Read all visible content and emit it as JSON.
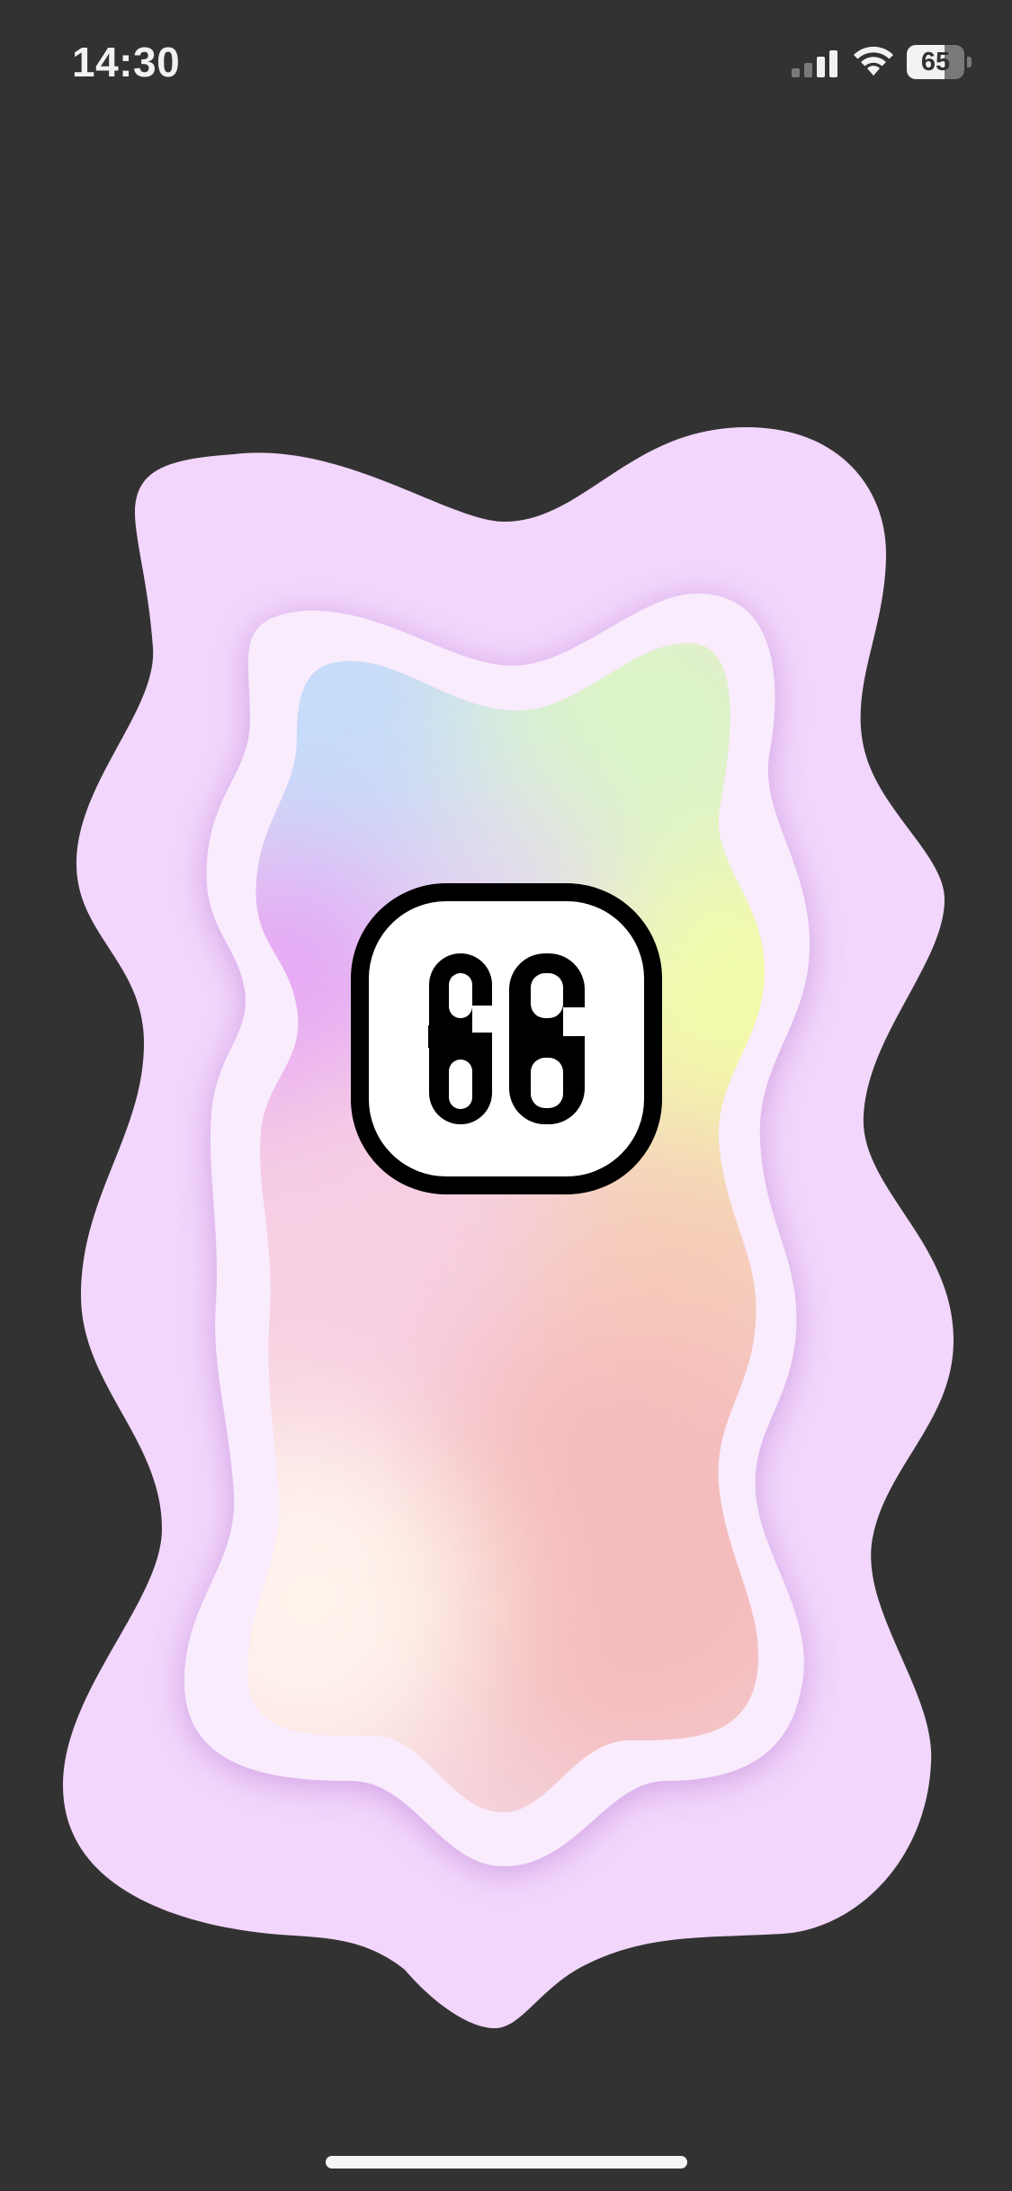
{
  "status_bar": {
    "time": "14:30",
    "battery_percent": 65,
    "battery_label": "65",
    "signal_bars_active": 2,
    "signal_bars_total": 4,
    "icons": [
      "cellular-signal-icon",
      "wifi-icon",
      "battery-icon"
    ]
  },
  "main": {
    "logo_digits": "66",
    "colors": {
      "background": "#323232",
      "outer_blob": "#f2d6fb",
      "middle_blob": "#f9ecfd",
      "gradient_blue": "#c6dcfa",
      "gradient_green": "#dcf5c8",
      "gradient_purple": "#e6a8f5",
      "gradient_yellow": "#f2fca9",
      "gradient_pink": "#f8cfe3",
      "gradient_salmon": "#f4bcbc",
      "gradient_cream": "#fff3ec",
      "logo_fill": "#ffffff",
      "logo_stroke": "#000000"
    }
  }
}
